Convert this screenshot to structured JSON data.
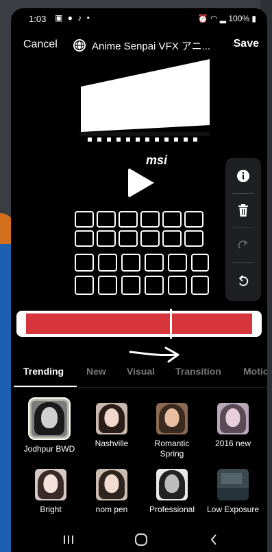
{
  "status": {
    "time": "1:03",
    "left_icons": [
      "gallery-icon",
      "messenger-icon",
      "tiktok-icon",
      "dot-icon"
    ],
    "battery": "100%",
    "right_icons": [
      "alarm-icon",
      "wifi-icon",
      "signal-icon",
      "battery-icon"
    ]
  },
  "topbar": {
    "cancel_label": "Cancel",
    "title": "Anime Senpai VFX アニ...",
    "save_label": "Save"
  },
  "player": {
    "play_icon": "play-icon"
  },
  "toolbar": {
    "icons": [
      "info-icon",
      "trash-icon",
      "redo-icon",
      "undo-icon"
    ]
  },
  "tabs": [
    "Trending",
    "New",
    "Visual",
    "Transition",
    "Motio"
  ],
  "active_tab": "Trending",
  "effects": [
    {
      "label": "Jodhpur BWD"
    },
    {
      "label": "Nashville"
    },
    {
      "label": "Romantic Spring"
    },
    {
      "label": "2016 new"
    },
    {
      "label": "Bright"
    },
    {
      "label": "nom pen"
    },
    {
      "label": "Professional"
    },
    {
      "label": "Low Exposure"
    }
  ],
  "colors": {
    "accent": "#d6363b",
    "background": "#000000"
  }
}
